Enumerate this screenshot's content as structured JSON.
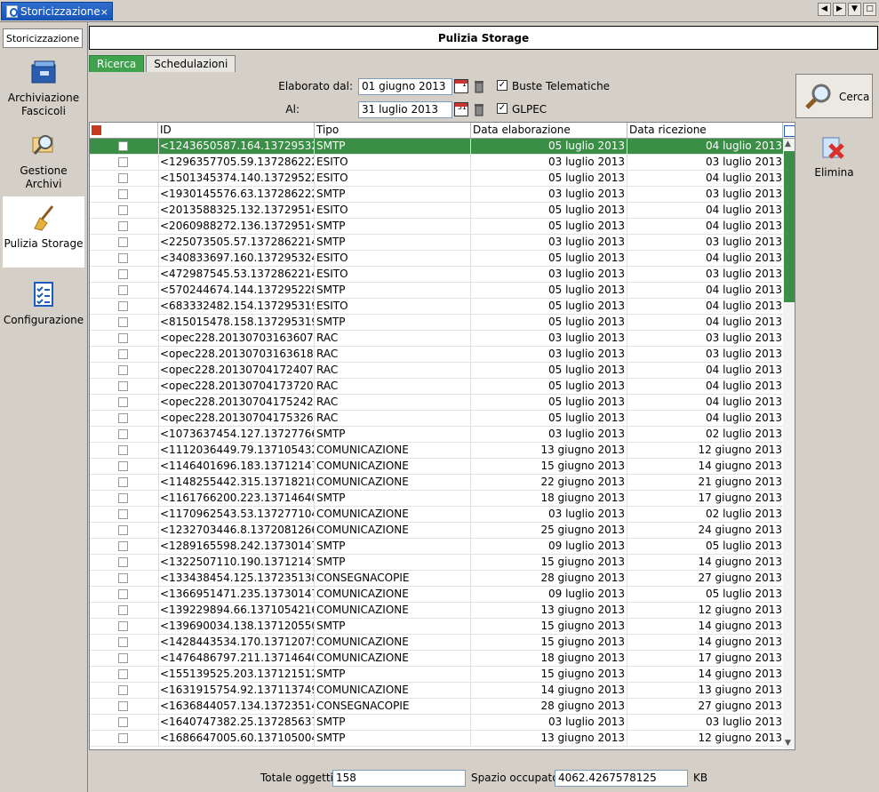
{
  "window": {
    "tab_title": "Storicizzazione",
    "tab_close": "×"
  },
  "sidebar": {
    "header": "Storicizzazione",
    "items": [
      {
        "label": "Archiviazione Fascicoli",
        "icon": "archive-folder-icon"
      },
      {
        "label": "Gestione Archivi",
        "icon": "search-archive-icon"
      },
      {
        "label": "Pulizia Storage",
        "icon": "broom-icon"
      },
      {
        "label": "Configurazione",
        "icon": "checklist-icon"
      }
    ]
  },
  "main": {
    "title": "Pulizia Storage",
    "tabs": [
      {
        "label": "Ricerca"
      },
      {
        "label": "Schedulazioni"
      }
    ],
    "filters": {
      "from_label": "Elaborato dal:",
      "from_value": "01 giugno 2013",
      "from_cal_day": "1",
      "to_label": "Al:",
      "to_value": "31 luglio 2013",
      "to_cal_day": "31",
      "buste_label": "Buste Telematiche",
      "glpec_label": "GLPEC",
      "check_mark": "✓"
    },
    "actions": {
      "search_label": "Cerca",
      "delete_label": "Elimina"
    },
    "table": {
      "columns": [
        "ID",
        "Tipo",
        "Data elaborazione",
        "Data ricezione"
      ],
      "rows": [
        [
          "<1243650587.164.13729532...",
          "SMTP",
          "05 luglio 2013",
          "04 luglio 2013"
        ],
        [
          "<1296357705.59.137286222...",
          "ESITO",
          "03 luglio 2013",
          "03 luglio 2013"
        ],
        [
          "<1501345374.140.13729522...",
          "ESITO",
          "05 luglio 2013",
          "04 luglio 2013"
        ],
        [
          "<1930145576.63.137286222...",
          "SMTP",
          "03 luglio 2013",
          "03 luglio 2013"
        ],
        [
          "<2013588325.132.13729514...",
          "ESITO",
          "05 luglio 2013",
          "04 luglio 2013"
        ],
        [
          "<2060988272.136.13729514...",
          "SMTP",
          "05 luglio 2013",
          "04 luglio 2013"
        ],
        [
          "<225073505.57.1372862214...",
          "SMTP",
          "03 luglio 2013",
          "03 luglio 2013"
        ],
        [
          "<340833697.160.137295324...",
          "ESITO",
          "05 luglio 2013",
          "04 luglio 2013"
        ],
        [
          "<472987545.53.1372862214...",
          "ESITO",
          "03 luglio 2013",
          "03 luglio 2013"
        ],
        [
          "<570244674.144.137295228...",
          "SMTP",
          "05 luglio 2013",
          "04 luglio 2013"
        ],
        [
          "<683332482.154.137295319...",
          "ESITO",
          "05 luglio 2013",
          "04 luglio 2013"
        ],
        [
          "<815015478.158.137295319...",
          "SMTP",
          "05 luglio 2013",
          "04 luglio 2013"
        ],
        [
          "<opec228.20130703163607....",
          "RAC",
          "03 luglio 2013",
          "03 luglio 2013"
        ],
        [
          "<opec228.20130703163618....",
          "RAC",
          "03 luglio 2013",
          "03 luglio 2013"
        ],
        [
          "<opec228.20130704172407....",
          "RAC",
          "05 luglio 2013",
          "04 luglio 2013"
        ],
        [
          "<opec228.20130704173720....",
          "RAC",
          "05 luglio 2013",
          "04 luglio 2013"
        ],
        [
          "<opec228.20130704175242....",
          "RAC",
          "05 luglio 2013",
          "04 luglio 2013"
        ],
        [
          "<opec228.20130704175326....",
          "RAC",
          "05 luglio 2013",
          "04 luglio 2013"
        ],
        [
          "<1073637454.127.13727766...",
          "SMTP",
          "03 luglio 2013",
          "02 luglio 2013"
        ],
        [
          "<1112036449.79.137105432...",
          "COMUNICAZIONE",
          "13 giugno 2013",
          "12 giugno 2013"
        ],
        [
          "<1146401696.183.13712147...",
          "COMUNICAZIONE",
          "15 giugno 2013",
          "14 giugno 2013"
        ],
        [
          "<1148255442.315.13718218...",
          "COMUNICAZIONE",
          "22 giugno 2013",
          "21 giugno 2013"
        ],
        [
          "<1161766200.223.13714640...",
          "SMTP",
          "18 giugno 2013",
          "17 giugno 2013"
        ],
        [
          "<1170962543.53.137277104...",
          "COMUNICAZIONE",
          "03 luglio 2013",
          "02 luglio 2013"
        ],
        [
          "<1232703446.8.1372081266...",
          "COMUNICAZIONE",
          "25 giugno 2013",
          "24 giugno 2013"
        ],
        [
          "<1289165598.242.13730147...",
          "SMTP",
          "09 luglio 2013",
          "05 luglio 2013"
        ],
        [
          "<1322507110.190.13712147...",
          "SMTP",
          "15 giugno 2013",
          "14 giugno 2013"
        ],
        [
          "<133438454.125.137235138...",
          "CONSEGNACOPIE",
          "28 giugno 2013",
          "27 giugno 2013"
        ],
        [
          "<1366951471.235.13730147...",
          "COMUNICAZIONE",
          "09 luglio 2013",
          "05 luglio 2013"
        ],
        [
          "<139229894.66.1371054216...",
          "COMUNICAZIONE",
          "13 giugno 2013",
          "12 giugno 2013"
        ],
        [
          "<139690034.138.137120550...",
          "SMTP",
          "15 giugno 2013",
          "14 giugno 2013"
        ],
        [
          "<1428443534.170.13712075...",
          "COMUNICAZIONE",
          "15 giugno 2013",
          "14 giugno 2013"
        ],
        [
          "<1476486797.211.13714640...",
          "COMUNICAZIONE",
          "18 giugno 2013",
          "17 giugno 2013"
        ],
        [
          "<155139525.203.137121512...",
          "SMTP",
          "15 giugno 2013",
          "14 giugno 2013"
        ],
        [
          "<1631915754.92.137113749...",
          "COMUNICAZIONE",
          "14 giugno 2013",
          "13 giugno 2013"
        ],
        [
          "<1636844057.134.13723514...",
          "CONSEGNACOPIE",
          "28 giugno 2013",
          "27 giugno 2013"
        ],
        [
          "<1640747382.25.137285637...",
          "SMTP",
          "03 luglio 2013",
          "03 luglio 2013"
        ],
        [
          "<1686647005.60.137105004...",
          "SMTP",
          "13 giugno 2013",
          "12 giugno 2013"
        ]
      ]
    },
    "footer": {
      "total_label": "Totale oggetti:",
      "total_value": "158",
      "space_label": "Spazio occupato:",
      "space_value": "4062.4267578125",
      "space_unit": "KB"
    }
  },
  "colors": {
    "accent_green": "#3a8e46",
    "tab_blue": "#1d5bbf"
  }
}
